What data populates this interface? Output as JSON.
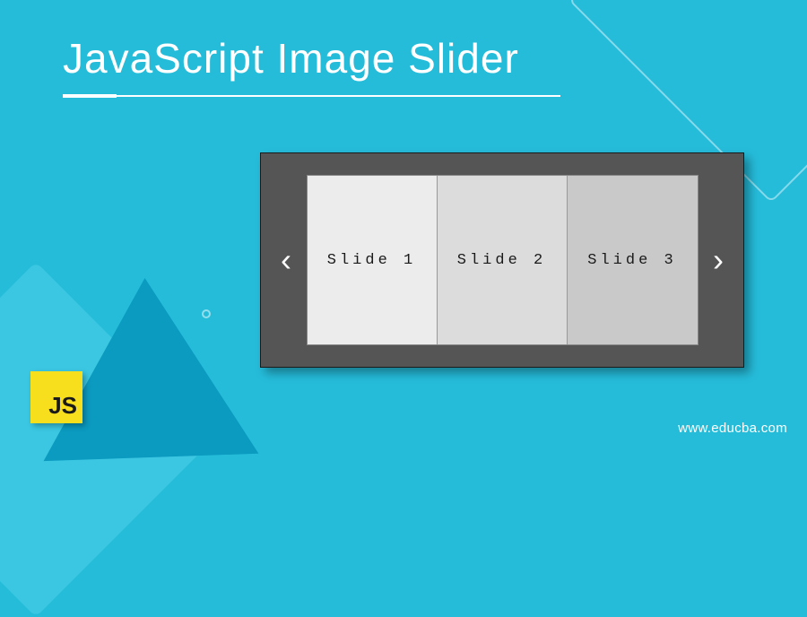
{
  "title": "JavaScript Image Slider",
  "slider": {
    "prev_symbol": "‹",
    "next_symbol": "›",
    "slides": [
      {
        "label": "Slide 1"
      },
      {
        "label": "Slide 2"
      },
      {
        "label": "Slide 3"
      }
    ]
  },
  "js_logo_text": "JS",
  "footer_url": "www.educba.com"
}
